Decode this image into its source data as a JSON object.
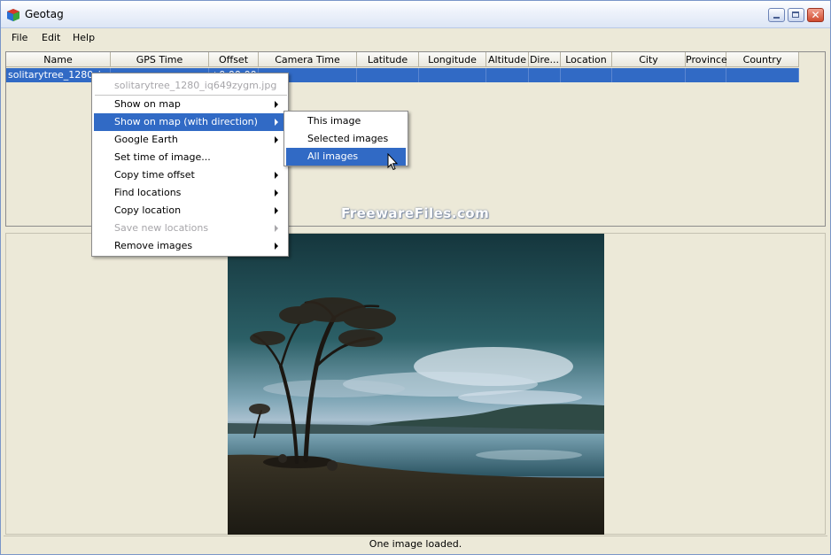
{
  "window": {
    "title": "Geotag"
  },
  "menubar": {
    "items": [
      "File",
      "Edit",
      "Help"
    ]
  },
  "grid": {
    "columns": [
      "Name",
      "GPS Time",
      "Offset",
      "Camera Time",
      "Latitude",
      "Longitude",
      "Altitude",
      "Dire...",
      "Location",
      "City",
      "Province",
      "Country"
    ],
    "row": {
      "name": "solitarytree_1280_iq",
      "offset": "+0:00:00"
    }
  },
  "context_menu": {
    "header": "solitarytree_1280_iq649zygm.jpg",
    "items": [
      {
        "label": "Show on map",
        "submenu": true,
        "state": "normal"
      },
      {
        "label": "Show on map (with direction)",
        "submenu": true,
        "state": "highlighted"
      },
      {
        "label": "Google Earth",
        "submenu": true,
        "state": "normal"
      },
      {
        "label": "Set time of image...",
        "submenu": false,
        "state": "normal"
      },
      {
        "label": "Copy time offset",
        "submenu": true,
        "state": "normal"
      },
      {
        "label": "Find locations",
        "submenu": true,
        "state": "normal"
      },
      {
        "label": "Copy location",
        "submenu": true,
        "state": "normal"
      },
      {
        "label": "Save new locations",
        "submenu": true,
        "state": "disabled"
      },
      {
        "label": "Remove images",
        "submenu": true,
        "state": "normal"
      }
    ]
  },
  "submenu": {
    "items": [
      {
        "label": "This image",
        "state": "normal"
      },
      {
        "label": "Selected images",
        "state": "normal"
      },
      {
        "label": "All images",
        "state": "highlighted"
      }
    ]
  },
  "watermark": "FreewareFiles.com",
  "status": {
    "text": "One image loaded."
  },
  "colors": {
    "selection": "#316ac5",
    "window_bg": "#ece9d8"
  },
  "icons": [
    "geotag-app-icon",
    "minimize-icon",
    "maximize-icon",
    "close-icon",
    "submenu-arrow-icon",
    "mouse-pointer-icon"
  ]
}
